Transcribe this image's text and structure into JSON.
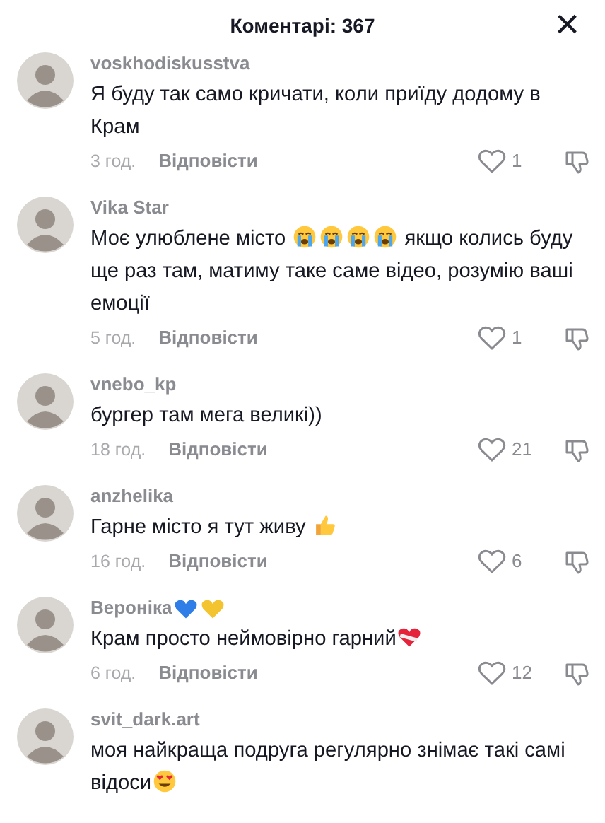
{
  "header": {
    "title": "Коментарі: 367",
    "close": "×"
  },
  "comments": [
    {
      "user": [
        {
          "kind": "text",
          "text": "voskhodiskusstva"
        }
      ],
      "body": [
        {
          "kind": "text",
          "text": "Я буду так само кричати, коли приїду додому в Крам"
        }
      ],
      "time": "3 год.",
      "reply": "Відповісти",
      "likes": "1",
      "liked": false
    },
    {
      "user": [
        {
          "kind": "text",
          "text": "Vika Star"
        }
      ],
      "body": [
        {
          "kind": "text",
          "text": "Моє улюблене місто "
        },
        {
          "kind": "sob"
        },
        {
          "kind": "sob"
        },
        {
          "kind": "sob"
        },
        {
          "kind": "sob"
        },
        {
          "kind": "text",
          "text": " якщо колись буду ще раз там, матиму таке саме відео, розумію ваші емоції"
        }
      ],
      "time": "5 год.",
      "reply": "Відповісти",
      "likes": "1",
      "liked": false
    },
    {
      "user": [
        {
          "kind": "text",
          "text": "vnebo_kp"
        }
      ],
      "body": [
        {
          "kind": "text",
          "text": "бургер там мега великі))"
        }
      ],
      "time": "18 год.",
      "reply": "Відповісти",
      "likes": "21",
      "liked": false
    },
    {
      "user": [
        {
          "kind": "text",
          "text": "anzhelika"
        }
      ],
      "body": [
        {
          "kind": "text",
          "text": "Гарне місто я тут живу "
        },
        {
          "kind": "thumbs"
        }
      ],
      "time": "16 год.",
      "reply": "Відповісти",
      "likes": "6",
      "liked": false
    },
    {
      "user": [
        {
          "kind": "text",
          "text": "Вероніка"
        },
        {
          "kind": "blueheart"
        },
        {
          "kind": "yellowheart"
        }
      ],
      "body": [
        {
          "kind": "text",
          "text": "Крам просто неймовірно гарний"
        },
        {
          "kind": "mendedheart"
        }
      ],
      "time": "6 год.",
      "reply": "Відповісти",
      "likes": "12",
      "liked": false
    },
    {
      "user": [
        {
          "kind": "text",
          "text": "svit_dark.art"
        }
      ],
      "body": [
        {
          "kind": "text",
          "text": "моя найкраща подруга регулярно знімає такі самі відоси"
        },
        {
          "kind": "hearteyes"
        }
      ]
    }
  ]
}
